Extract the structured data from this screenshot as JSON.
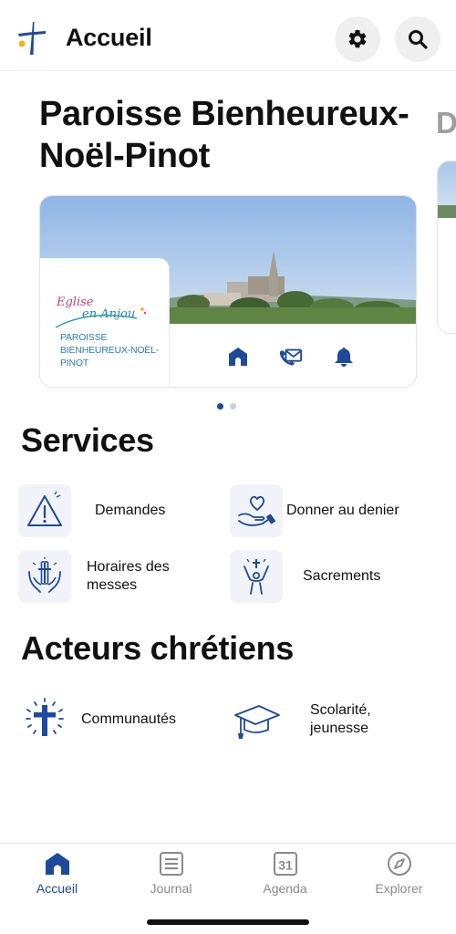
{
  "header": {
    "title": "Accueil",
    "logo_icon": "cross-logo-icon",
    "settings_icon": "gear-icon",
    "search_icon": "search-icon"
  },
  "parish_carousel": {
    "current": {
      "title": "Paroisse Bienheureux-Noël-Pinot",
      "logo_script_line1": "Eglise",
      "logo_script_line2": "en Anjou",
      "logo_parish_name": "PAROISSE BIENHEUREUX-NOËL-PINOT",
      "actions": [
        {
          "icon": "church-icon"
        },
        {
          "icon": "contact-phone-mail-icon"
        },
        {
          "icon": "bell-icon"
        }
      ]
    },
    "next_peek_title": "D",
    "page_count": 2,
    "active_page": 1
  },
  "services": {
    "title": "Services",
    "items": [
      {
        "label": "Demandes",
        "icon": "warning-triangle-icon"
      },
      {
        "label": "Donner au denier",
        "icon": "heart-in-hand-icon"
      },
      {
        "label": "Horaires des messes",
        "icon": "cross-in-hands-icon"
      },
      {
        "label": "Sacrements",
        "icon": "person-praising-cross-icon"
      }
    ]
  },
  "acteurs": {
    "title": "Acteurs chrétiens",
    "items": [
      {
        "label": "Communautés",
        "icon": "radiant-cross-icon"
      },
      {
        "label": "Scolarité, jeunesse",
        "icon": "graduation-cap-icon"
      }
    ]
  },
  "tab_bar": {
    "tabs": [
      {
        "label": "Accueil",
        "icon": "home-icon",
        "active": true
      },
      {
        "label": "Journal",
        "icon": "newspaper-icon",
        "active": false
      },
      {
        "label": "Agenda",
        "icon": "calendar-icon",
        "day": "31",
        "active": false
      },
      {
        "label": "Explorer",
        "icon": "compass-icon",
        "active": false
      }
    ]
  },
  "colors": {
    "accent": "#1d4a9a",
    "logo_teal": "#2b7fa6",
    "tile_background": "#f1f3f8",
    "inactive_tab": "#8a8a8a"
  }
}
